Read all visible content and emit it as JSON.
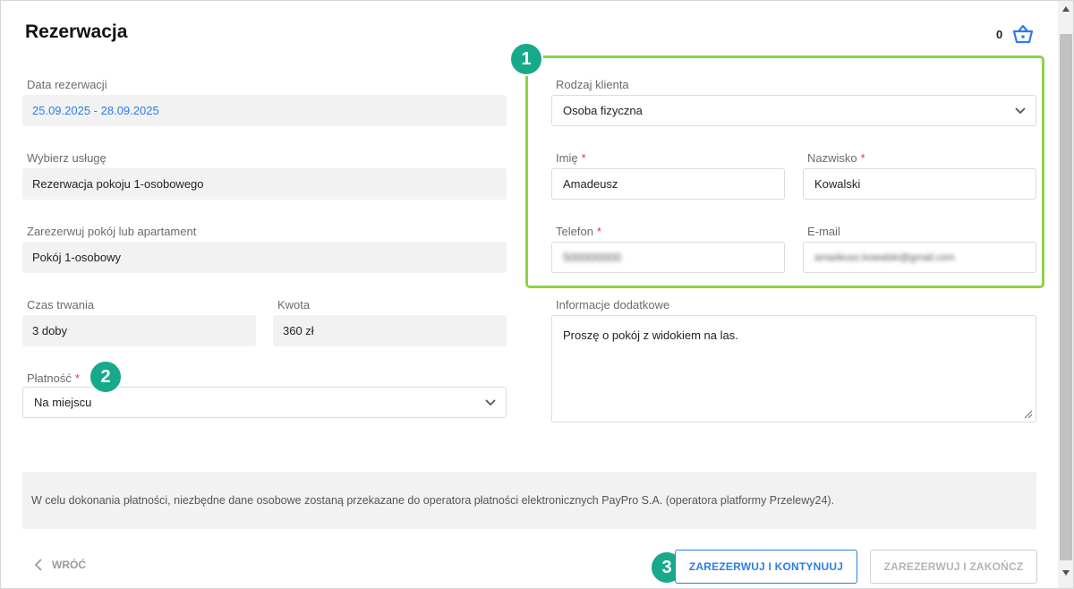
{
  "header": {
    "title": "Rezerwacja",
    "cart_count": "0",
    "cart_icon": "basket-icon"
  },
  "left": {
    "date_label": "Data rezerwacji",
    "date_value": "25.09.2025 - 28.09.2025",
    "service_label": "Wybierz usługę",
    "service_value": "Rezerwacja pokoju 1-osobowego",
    "room_label": "Zarezerwuj pokój lub apartament",
    "room_value": "Pokój 1-osobowy",
    "duration_label": "Czas trwania",
    "duration_value": "3 doby",
    "amount_label": "Kwota",
    "amount_value": "360 zł",
    "payment_label": "Płatność",
    "payment_value": "Na miejscu"
  },
  "right": {
    "client_type_label": "Rodzaj klienta",
    "client_type_value": "Osoba fizyczna",
    "first_name_label": "Imię",
    "first_name_value": "Amadeusz",
    "last_name_label": "Nazwisko",
    "last_name_value": "Kowalski",
    "phone_label": "Telefon",
    "phone_value": "500000000",
    "email_label": "E-mail",
    "email_value": "amadeusz.kowalski@gmail.com",
    "extra_label": "Informacje dodatkowe",
    "extra_value": "Proszę o pokój z widokiem na las."
  },
  "required_mark": "*",
  "badges": {
    "one": "1",
    "two": "2",
    "three": "3"
  },
  "info_text": "W celu dokonania płatności, niezbędne dane osobowe zostaną przekazane do operatora płatności elektronicznych PayPro S.A. (operatora platformy Przelewy24).",
  "footer": {
    "back_label": "WRÓĆ",
    "reserve_continue_label": "ZAREZERWUJ I KONTYNUUJ",
    "reserve_finish_label": "ZAREZERWUJ I ZAKOŃCZ"
  },
  "colors": {
    "accent": "#2b7de9",
    "badge": "#17a98a",
    "highlight": "#8dd14a",
    "required": "#e53935"
  }
}
